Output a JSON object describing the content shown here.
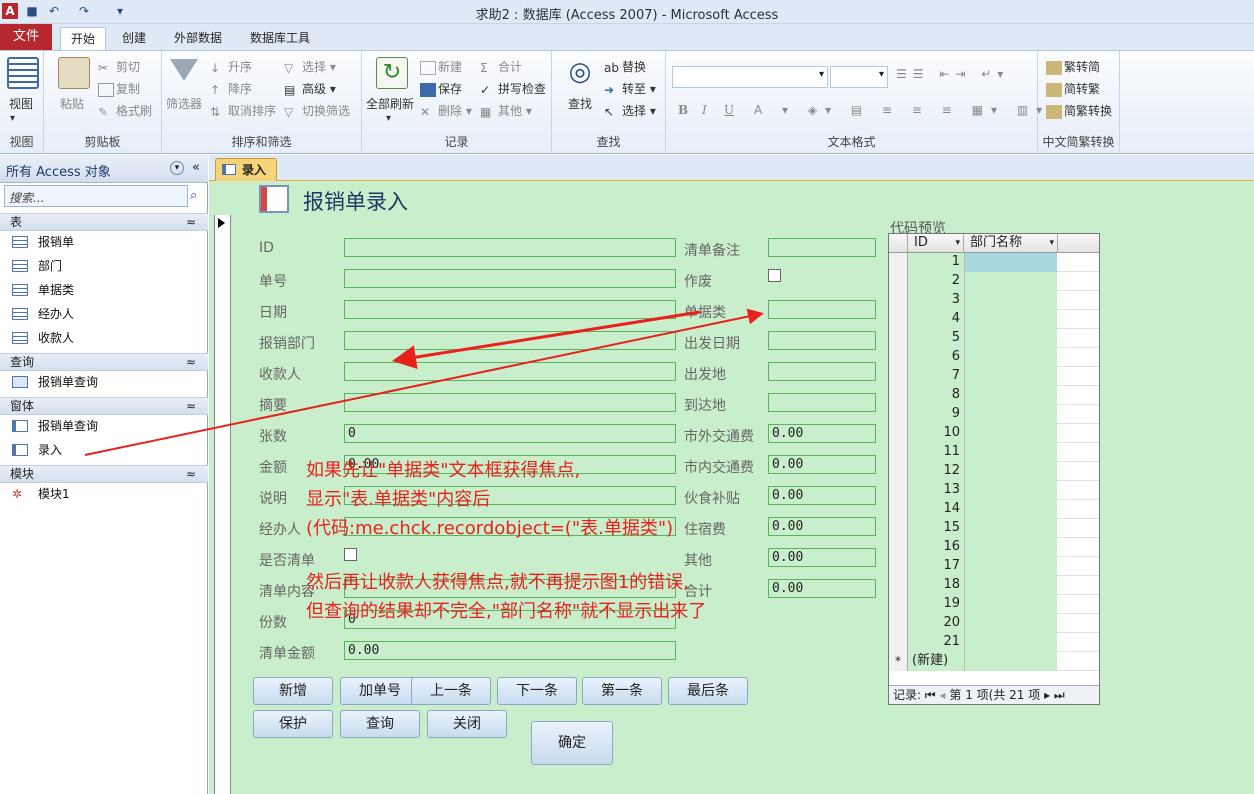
{
  "window": {
    "title": "求助2 : 数据库 (Access 2007) - Microsoft Access"
  },
  "quick_access": [
    "save-icon",
    "undo-icon",
    "redo-icon",
    "customize-icon"
  ],
  "tabs": {
    "file": "文件",
    "items": [
      "开始",
      "创建",
      "外部数据",
      "数据库工具"
    ]
  },
  "ribbon": {
    "view": {
      "button": "视图",
      "group": "视图"
    },
    "clipboard": {
      "paste": "粘贴",
      "cut": "剪切",
      "copy": "复制",
      "format": "格式刷",
      "group": "剪贴板"
    },
    "sort": {
      "filter": "筛选器",
      "asc": "升序",
      "desc": "降序",
      "remove": "取消排序",
      "select": "选择",
      "advanced": "高级",
      "toggle": "切换筛选",
      "group": "排序和筛选"
    },
    "records": {
      "refresh": "全部刷新",
      "new": "新建",
      "save": "保存",
      "delete": "删除",
      "total": "合计",
      "spell": "拼写检查",
      "more": "其他",
      "group": "记录"
    },
    "find": {
      "find": "查找",
      "replace": "替换",
      "goto": "转至",
      "select": "选择",
      "group": "查找"
    },
    "textfmt": {
      "group": "文本格式",
      "bold": "B",
      "italic": "I",
      "underline": "U",
      "fontcolor": "A"
    },
    "chinese": {
      "t2s": "繁转简",
      "s2t": "简转繁",
      "conv": "简繁转换",
      "group": "中文简繁转换"
    }
  },
  "nav": {
    "title": "所有 Access 对象",
    "search_placeholder": "搜索...",
    "sections": [
      {
        "name": "表",
        "items": [
          "报销单",
          "部门",
          "单据类",
          "经办人",
          "收款人"
        ]
      },
      {
        "name": "查询",
        "items": [
          "报销单查询"
        ]
      },
      {
        "name": "窗体",
        "items": [
          "报销单查询",
          "录入"
        ]
      },
      {
        "name": "模块",
        "items": [
          "模块1"
        ]
      }
    ]
  },
  "document": {
    "tab": "录入",
    "form_title": "报销单录入"
  },
  "form": {
    "left_fields": [
      {
        "label": "ID",
        "value": ""
      },
      {
        "label": "单号",
        "value": ""
      },
      {
        "label": "日期",
        "value": ""
      },
      {
        "label": "报销部门",
        "value": ""
      },
      {
        "label": "收款人",
        "value": ""
      },
      {
        "label": "摘要",
        "value": ""
      },
      {
        "label": "张数",
        "value": "0"
      },
      {
        "label": "金额",
        "value": "0.00"
      },
      {
        "label": "说明",
        "value": ""
      },
      {
        "label": "经办人",
        "value": ""
      },
      {
        "label": "是否清单",
        "value": ""
      },
      {
        "label": "清单内容",
        "value": ""
      },
      {
        "label": "份数",
        "value": "0"
      },
      {
        "label": "清单金额",
        "value": "0.00"
      }
    ],
    "right_fields": [
      {
        "label": "清单备注",
        "value": ""
      },
      {
        "label": "作废",
        "value": ""
      },
      {
        "label": "单据类",
        "value": ""
      },
      {
        "label": "出发日期",
        "value": ""
      },
      {
        "label": "出发地",
        "value": ""
      },
      {
        "label": "到达地",
        "value": ""
      },
      {
        "label": "市外交通费",
        "value": "0.00"
      },
      {
        "label": "市内交通费",
        "value": "0.00"
      },
      {
        "label": "伙食补贴",
        "value": "0.00"
      },
      {
        "label": "住宿费",
        "value": "0.00"
      },
      {
        "label": "其他",
        "value": "0.00"
      },
      {
        "label": "合计",
        "value": "0.00"
      }
    ],
    "buttons_row1": [
      "新增",
      "加单号",
      "上一条",
      "下一条",
      "第一条",
      "最后条"
    ],
    "buttons_row2": [
      "保护",
      "查询",
      "关闭"
    ],
    "confirm": "确定"
  },
  "subform": {
    "caption": "代码预览",
    "columns": [
      "ID",
      "部门名称"
    ],
    "ids": [
      "1",
      "2",
      "3",
      "4",
      "5",
      "6",
      "7",
      "8",
      "9",
      "10",
      "11",
      "12",
      "13",
      "14",
      "15",
      "16",
      "17",
      "18",
      "19",
      "20",
      "21"
    ],
    "new_row": "(新建)",
    "new_marker": "*",
    "record_label": "记录:",
    "record_pos": "第 1 项(共 21 项"
  },
  "annotation": {
    "lines": [
      "如果先让\"单据类\"文本框获得焦点,",
      "显示\"表.单据类\"内容后",
      "(代码:me.chck.recordobject=(\"表.单据类\")",
      "然后再让收款人获得焦点,就不再提示图1的错误,",
      "但查询的结果却不完全,\"部门名称\"就不显示出来了"
    ],
    "color": "#e8211c"
  }
}
